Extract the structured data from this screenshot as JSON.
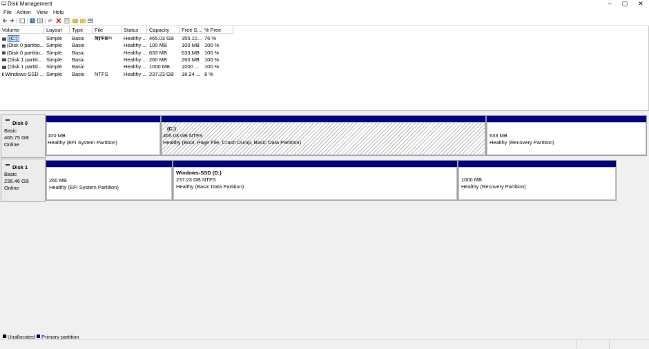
{
  "window": {
    "title": "Disk Management",
    "controls": {
      "minimize": "–",
      "maximize": "▢",
      "close": "✕"
    }
  },
  "menu": [
    "File",
    "Action",
    "View",
    "Help"
  ],
  "toolbar": {
    "icons": [
      "back-arrow-icon",
      "forward-arrow-icon",
      "console-tree-icon",
      "help-icon",
      "properties-icon",
      "connect-icon",
      "delete-icon",
      "export-icon",
      "open-icon",
      "refresh-icon",
      "view-icon"
    ],
    "colors": {
      "delete": "#d81e1e",
      "help": "#2f6fbf",
      "folder": "#e8b84a"
    }
  },
  "columns": [
    "Volume",
    "Layout",
    "Type",
    "File System",
    "Status",
    "Capacity",
    "Free S...",
    "% Free"
  ],
  "volumes": [
    {
      "volume": "(C:)",
      "layout": "Simple",
      "type": "Basic",
      "fs": "NTFS",
      "status": "Healthy ...",
      "capacity": "465.03 GB",
      "free": "355.10...",
      "pct": "76 %",
      "selected": true
    },
    {
      "volume": "(Disk 0 partitio...",
      "layout": "Simple",
      "type": "Basic",
      "fs": "",
      "status": "Healthy ...",
      "capacity": "100 MB",
      "free": "100 MB",
      "pct": "100 %"
    },
    {
      "volume": "(Disk 0 partitio...",
      "layout": "Simple",
      "type": "Basic",
      "fs": "",
      "status": "Healthy ...",
      "capacity": "633 MB",
      "free": "633 MB",
      "pct": "100 %"
    },
    {
      "volume": "(Disk 1 partiti...",
      "layout": "Simple",
      "type": "Basic",
      "fs": "",
      "status": "Healthy ...",
      "capacity": "260 MB",
      "free": "260 MB",
      "pct": "100 %"
    },
    {
      "volume": "(Disk 1 partiti...",
      "layout": "Simple",
      "type": "Basic",
      "fs": "",
      "status": "Healthy ...",
      "capacity": "1000 MB",
      "free": "1000 ...",
      "pct": "100 %"
    },
    {
      "volume": "Windows-SSD ...",
      "layout": "Simple",
      "type": "Basic",
      "fs": "NTFS",
      "status": "Healthy ...",
      "capacity": "237.23 GB",
      "free": "18.24 ...",
      "pct": "8 %"
    }
  ],
  "disks": [
    {
      "name": "Disk 0",
      "type": "Basic",
      "size": "465.75 GB",
      "state": "Online",
      "partitions": [
        {
          "title": "",
          "line1": "100 MB",
          "line2": "Healthy (EFI System Partition)",
          "hatched": false
        },
        {
          "title": "(C:)",
          "line1": "465.03 GB NTFS",
          "line2": "Healthy (Boot, Page File, Crash Dump, Basic Data Partition)",
          "hatched": true
        },
        {
          "title": "",
          "line1": "633 MB",
          "line2": "Healthy (Recovery Partition)",
          "hatched": false
        }
      ]
    },
    {
      "name": "Disk 1",
      "type": "Basic",
      "size": "238.46 GB",
      "state": "Online",
      "partitions": [
        {
          "title": "",
          "line1": "260 MB",
          "line2": "Healthy (EFI System Partition)",
          "hatched": false
        },
        {
          "title": "Windows-SSD  (D:)",
          "line1": "237.23 GB NTFS",
          "line2": "Healthy (Basic Data Partition)",
          "hatched": false
        },
        {
          "title": "",
          "line1": "1000 MB",
          "line2": "Healthy (Recovery Partition)",
          "hatched": false
        }
      ]
    }
  ],
  "legend": [
    {
      "label": "Unallocated",
      "color": "#000000"
    },
    {
      "label": "Primary partition",
      "color": "#00007f"
    }
  ]
}
